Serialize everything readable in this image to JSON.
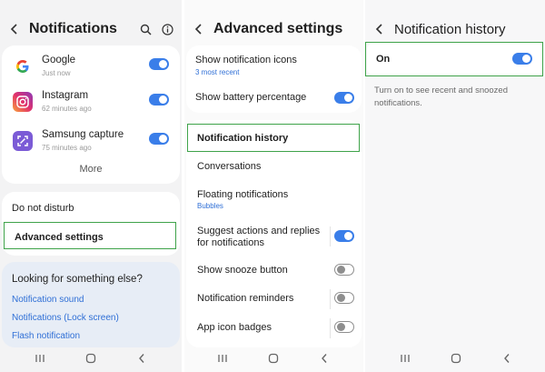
{
  "panel_notifications": {
    "title": "Notifications",
    "apps": [
      {
        "name": "Google",
        "time": "Just now",
        "enabled": true
      },
      {
        "name": "Instagram",
        "time": "62 minutes ago",
        "enabled": true
      },
      {
        "name": "Samsung capture",
        "time": "75 minutes ago",
        "enabled": true
      }
    ],
    "more_label": "More",
    "do_not_disturb": "Do not disturb",
    "advanced_settings": "Advanced settings",
    "looking_title": "Looking for something else?",
    "links": [
      "Notification sound",
      "Notifications (Lock screen)",
      "Flash notification"
    ]
  },
  "panel_advanced": {
    "title": "Advanced settings",
    "show_icons_label": "Show notification icons",
    "show_icons_sub": "3 most recent",
    "battery_label": "Show battery percentage",
    "battery_enabled": true,
    "history_label": "Notification history",
    "conversations_label": "Conversations",
    "floating_label": "Floating notifications",
    "floating_sub": "Bubbles",
    "suggest_label_1": "Suggest actions and replies",
    "suggest_label_2": "for notifications",
    "suggest_enabled": true,
    "snooze_label": "Show snooze button",
    "snooze_enabled": false,
    "reminders_label": "Notification reminders",
    "reminders_enabled": false,
    "badges_label": "App icon badges",
    "badges_enabled": false
  },
  "panel_history": {
    "title": "Notification history",
    "on_label": "On",
    "on_enabled": true,
    "description": "Turn on to see recent and snoozed notifications."
  },
  "colors": {
    "accent": "#3a7ee9",
    "highlight": "#3fa34a",
    "link": "#2f6fd6"
  },
  "icons": {
    "back": "chevron-left-icon",
    "search": "search-icon",
    "info": "info-icon",
    "nav_recents": "recents-icon",
    "nav_home": "home-icon",
    "nav_back": "back-icon"
  }
}
